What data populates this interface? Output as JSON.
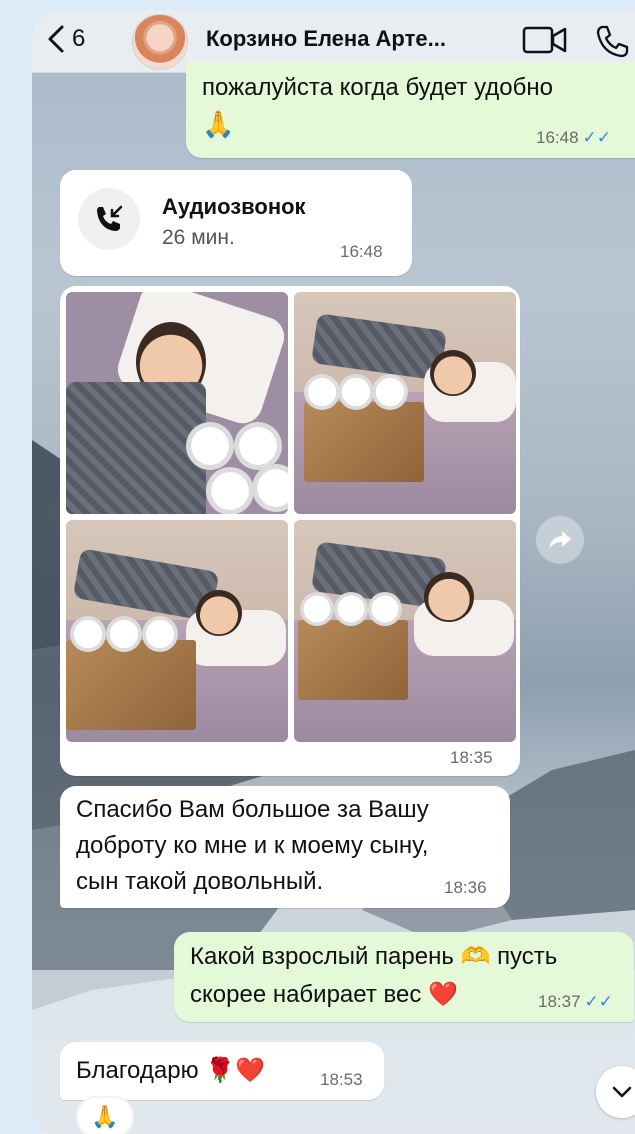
{
  "header": {
    "back_count": "6",
    "contact_name": "Корзино Елена Арте...",
    "icons": [
      "chevron-left-icon",
      "video-camera-icon",
      "phone-icon"
    ]
  },
  "messages": {
    "partial_out": {
      "text": "пожалуйста когда будет удобно",
      "emoji": "🙏",
      "time": "16:48",
      "ticks": "✓✓"
    },
    "call": {
      "title": "Аудиозвонок",
      "duration": "26 мин.",
      "time": "16:48"
    },
    "photos": {
      "count": 4,
      "time": "18:35"
    },
    "thanks_in": {
      "line1": "Спасибо Вам большое за Вашу",
      "line2": "доброту ко мне и к моему сыну,",
      "line3": "сын такой довольный.",
      "time": "18:36"
    },
    "reply_out": {
      "line1a": "Какой взрослый парень",
      "emoji1": "🫶",
      "line1b": "пусть",
      "line2": "скорее набирает вес",
      "emoji2": "❤️",
      "time": "18:37",
      "ticks": "✓✓"
    },
    "grateful_in": {
      "text": "Благодарю",
      "emoji": "🌹❤️",
      "time": "18:53",
      "reaction": "🙏"
    }
  },
  "colors": {
    "outgoing_bubble": "#e3f9d7",
    "incoming_bubble": "#ffffff",
    "read_ticks": "#3b82f6"
  }
}
